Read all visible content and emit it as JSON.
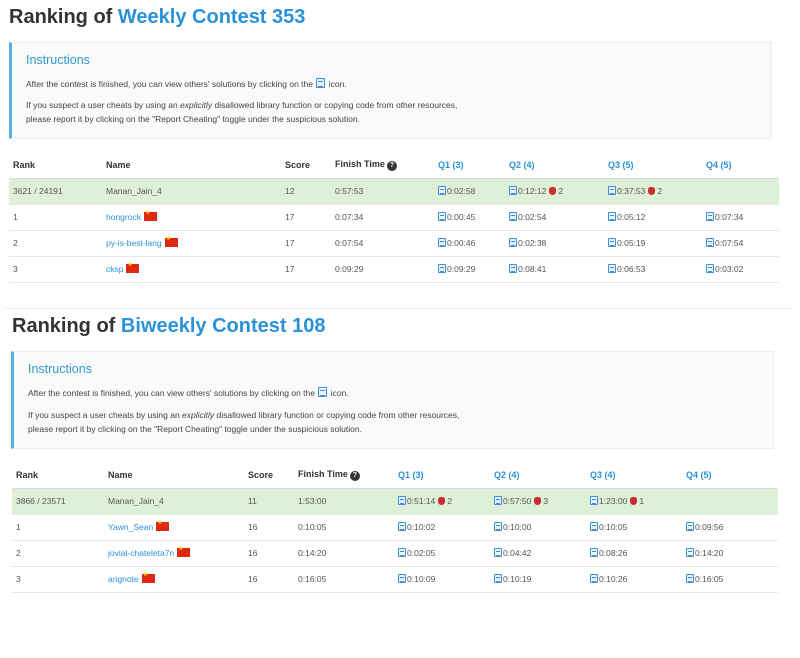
{
  "panels": [
    {
      "title_prefix": "Ranking of",
      "contest_name": "Weekly Contest 353",
      "instructions": {
        "title": "Instructions",
        "line1_before": "After the contest is finished, you can view others' solutions by clicking on the",
        "line1_after": "icon.",
        "line2_before": "If you suspect a user cheats by using an",
        "line2_em": "explicitly",
        "line2_after": "disallowed library function or copying code from other resources,",
        "line3": "please report it by clicking on the \"Report Cheating\" toggle under the suspicious solution."
      },
      "headers": {
        "rank": "Rank",
        "name": "Name",
        "score": "Score",
        "finish_time": "Finish Time"
      },
      "questions": [
        "Q1 (3)",
        "Q2 (4)",
        "Q3 (5)",
        "Q4 (5)"
      ],
      "rows": [
        {
          "rank": "3621 / 24191",
          "name": "Manan_Jain_4",
          "highlight": true,
          "link": false,
          "flag": false,
          "score": "12",
          "finish": "0:57:53",
          "q": [
            {
              "time": "0:02:58",
              "bugs": ""
            },
            {
              "time": "0:12:12",
              "bugs": "2"
            },
            {
              "time": "0:37:53",
              "bugs": "2"
            },
            {
              "time": "",
              "bugs": ""
            }
          ]
        },
        {
          "rank": "1",
          "name": "hongrock",
          "highlight": false,
          "link": true,
          "flag": true,
          "score": "17",
          "finish": "0:07:34",
          "q": [
            {
              "time": "0:00:45",
              "bugs": ""
            },
            {
              "time": "0:02:54",
              "bugs": ""
            },
            {
              "time": "0:05:12",
              "bugs": ""
            },
            {
              "time": "0:07:34",
              "bugs": ""
            }
          ]
        },
        {
          "rank": "2",
          "name": "py-is-best-lang",
          "highlight": false,
          "link": true,
          "flag": true,
          "score": "17",
          "finish": "0:07:54",
          "q": [
            {
              "time": "0:00:46",
              "bugs": ""
            },
            {
              "time": "0:02:38",
              "bugs": ""
            },
            {
              "time": "0:05:19",
              "bugs": ""
            },
            {
              "time": "0:07:54",
              "bugs": ""
            }
          ]
        },
        {
          "rank": "3",
          "name": "cksp",
          "highlight": false,
          "link": true,
          "flag": true,
          "score": "17",
          "finish": "0:09:29",
          "q": [
            {
              "time": "0:09:29",
              "bugs": ""
            },
            {
              "time": "0:08:41",
              "bugs": ""
            },
            {
              "time": "0:06:53",
              "bugs": ""
            },
            {
              "time": "0:03:02",
              "bugs": ""
            }
          ]
        }
      ]
    },
    {
      "title_prefix": "Ranking of",
      "contest_name": "Biweekly Contest 108",
      "instructions": {
        "title": "Instructions",
        "line1_before": "After the contest is finished, you can view others' solutions by clicking on the",
        "line1_after": "icon.",
        "line2_before": "If you suspect a user cheats by using an",
        "line2_em": "explicitly",
        "line2_after": "disallowed library function or copying code from other resources,",
        "line3": "please report it by clicking on the \"Report Cheating\" toggle under the suspicious solution."
      },
      "headers": {
        "rank": "Rank",
        "name": "Name",
        "score": "Score",
        "finish_time": "Finish Time"
      },
      "questions": [
        "Q1 (3)",
        "Q2 (4)",
        "Q3 (4)",
        "Q4 (5)"
      ],
      "rows": [
        {
          "rank": "3866 / 23571",
          "name": "Manan_Jain_4",
          "highlight": true,
          "link": false,
          "flag": false,
          "score": "11",
          "finish": "1:53:00",
          "q": [
            {
              "time": "0:51:14",
              "bugs": "2"
            },
            {
              "time": "0:57:50",
              "bugs": "3"
            },
            {
              "time": "1:23:00",
              "bugs": "1"
            },
            {
              "time": "",
              "bugs": ""
            }
          ]
        },
        {
          "rank": "1",
          "name": "Yawn_Sean",
          "highlight": false,
          "link": true,
          "flag": true,
          "score": "16",
          "finish": "0:10:05",
          "q": [
            {
              "time": "0:10:02",
              "bugs": ""
            },
            {
              "time": "0:10:00",
              "bugs": ""
            },
            {
              "time": "0:10:05",
              "bugs": ""
            },
            {
              "time": "0:09:56",
              "bugs": ""
            }
          ]
        },
        {
          "rank": "2",
          "name": "jovial-chateleta7n",
          "highlight": false,
          "link": true,
          "flag": true,
          "score": "16",
          "finish": "0:14:20",
          "q": [
            {
              "time": "0:02:05",
              "bugs": ""
            },
            {
              "time": "0:04:42",
              "bugs": ""
            },
            {
              "time": "0:08:26",
              "bugs": ""
            },
            {
              "time": "0:14:20",
              "bugs": ""
            }
          ]
        },
        {
          "rank": "3",
          "name": "arignote",
          "highlight": false,
          "link": true,
          "flag": true,
          "score": "16",
          "finish": "0:16:05",
          "q": [
            {
              "time": "0:10:09",
              "bugs": ""
            },
            {
              "time": "0:10:19",
              "bugs": ""
            },
            {
              "time": "0:10:26",
              "bugs": ""
            },
            {
              "time": "0:16:05",
              "bugs": ""
            }
          ]
        }
      ]
    }
  ]
}
